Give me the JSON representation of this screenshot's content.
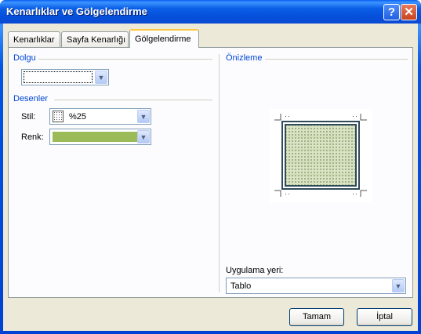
{
  "window": {
    "title": "Kenarlıklar ve Gölgelendirme",
    "help_glyph": "?",
    "close_glyph": "✕"
  },
  "tabs": [
    {
      "label": "Kenarlıklar",
      "mnemonic": "K"
    },
    {
      "label": "Sayfa Kenarlığı",
      "mnemonic": "S"
    },
    {
      "label": "Gölgelendirme",
      "mnemonic": "G"
    }
  ],
  "active_tab": "Gölgelendirme",
  "fill": {
    "group_label": "Dolgu",
    "value": ""
  },
  "patterns": {
    "group_label": "Desenler",
    "style_label": "Stil:",
    "style_value": "%25",
    "color_label": "Renk:",
    "color_value": "#9bbb59"
  },
  "preview": {
    "group_label": "Önizleme"
  },
  "apply_to": {
    "label": "Uygulama yeri:",
    "value": "Tablo"
  },
  "buttons": {
    "ok": "Tamam",
    "cancel": "İptal"
  },
  "colors": {
    "title_bar": "#0550dc",
    "group_label": "#0046d5",
    "dialog_bg": "#ece9d8"
  },
  "icons": {
    "dropdown": "chevron-down-icon",
    "help": "help-icon",
    "close": "close-icon"
  }
}
